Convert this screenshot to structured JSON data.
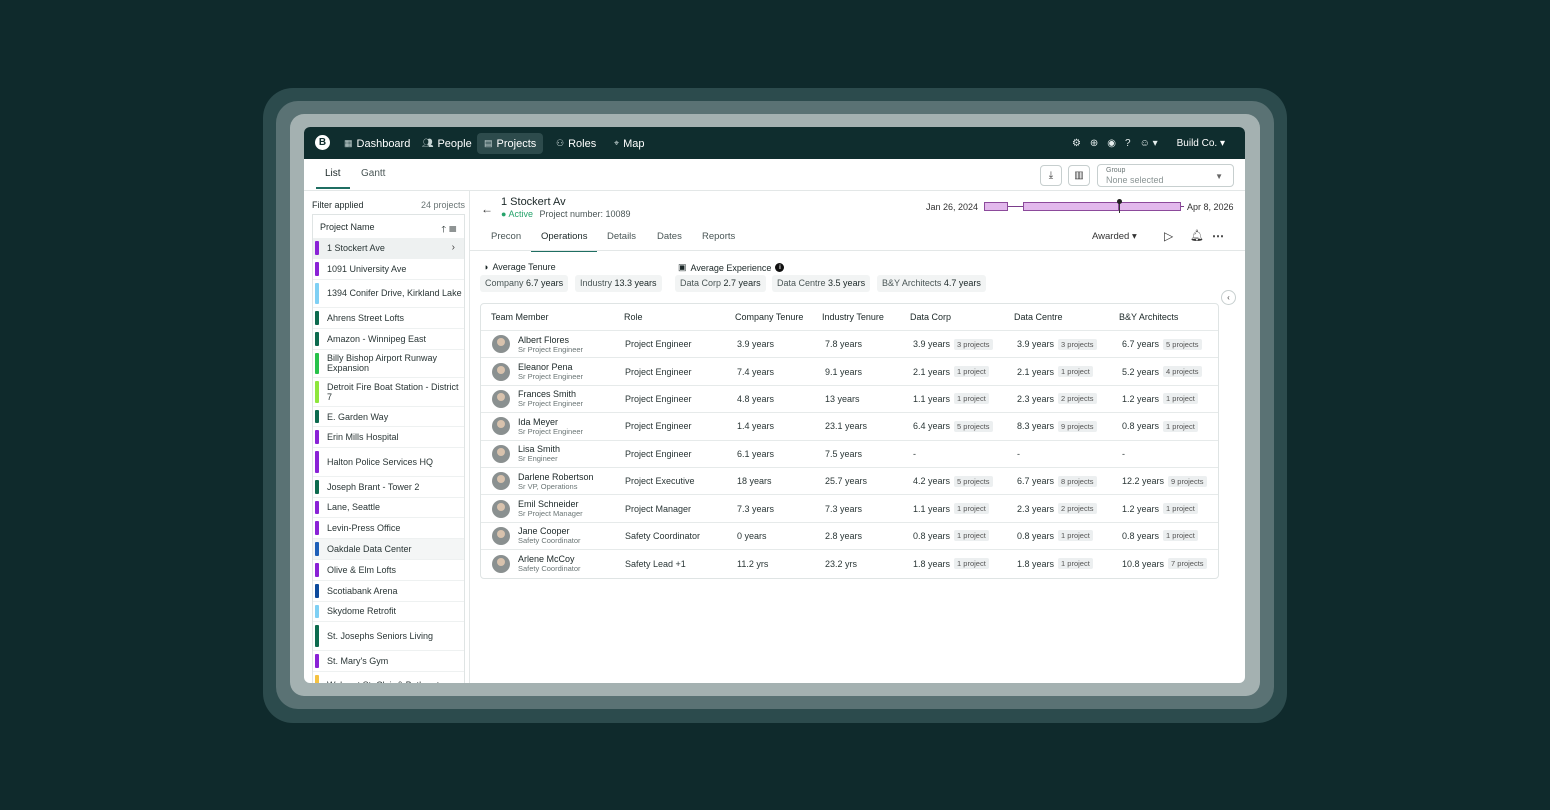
{
  "nav": {
    "logo": "B",
    "items": [
      {
        "label": "Dashboard",
        "icon": "grid-icon"
      },
      {
        "label": "People",
        "icon": "people-icon"
      },
      {
        "label": "Projects",
        "icon": "building-icon"
      },
      {
        "label": "Roles",
        "icon": "roles-icon"
      },
      {
        "label": "Map",
        "icon": "pin-icon"
      }
    ],
    "company": "Build Co."
  },
  "views": {
    "list": "List",
    "gantt": "Gantt"
  },
  "group": {
    "label": "Group",
    "value": "None selected"
  },
  "sidebar": {
    "filter_label": "Filter applied",
    "count": "24 projects",
    "column_header": "Project Name",
    "projects": [
      {
        "name": "1 Stockert Ave",
        "color": "#8a22d6"
      },
      {
        "name": "1091 University Ave",
        "color": "#8a22d6"
      },
      {
        "name": "1394 Conifer Drive, Kirkland Lake",
        "color": "#7fd0f4"
      },
      {
        "name": "Ahrens Street Lofts",
        "color": "#0d6b4e"
      },
      {
        "name": "Amazon - Winnipeg East",
        "color": "#0d6b4e"
      },
      {
        "name": "Billy Bishop Airport Runway Expansion",
        "color": "#27c24a"
      },
      {
        "name": "Detroit Fire Boat Station - District 7",
        "color": "#8ee63c"
      },
      {
        "name": "E. Garden Way",
        "color": "#0d6b4e"
      },
      {
        "name": "Erin Mills Hospital",
        "color": "#8a22d6"
      },
      {
        "name": "Halton Police Services HQ",
        "color": "#8a22d6"
      },
      {
        "name": "Joseph Brant - Tower 2",
        "color": "#0d6b4e"
      },
      {
        "name": "Lane, Seattle",
        "color": "#8a22d6"
      },
      {
        "name": "Levin-Press Office",
        "color": "#8a22d6"
      },
      {
        "name": "Oakdale Data Center",
        "color": "#1e5fb8"
      },
      {
        "name": "Olive & Elm Lofts",
        "color": "#8a22d6"
      },
      {
        "name": "Scotiabank Arena",
        "color": "#0d4a9c"
      },
      {
        "name": "Skydome Retrofit",
        "color": "#7fd0f4"
      },
      {
        "name": "St. Josephs Seniors Living",
        "color": "#0d6b4e"
      },
      {
        "name": "St. Mary's Gym",
        "color": "#8a22d6"
      },
      {
        "name": "Walmart St. Clair & Bathurst",
        "color": "#f5c242"
      }
    ]
  },
  "project": {
    "title": "1 Stockert Av",
    "status": "Active",
    "number": "Project number: 10089",
    "start_date": "Jan 26, 2024",
    "end_date": "Apr 8, 2026",
    "tabs": [
      "Precon",
      "Operations",
      "Details",
      "Dates",
      "Reports"
    ],
    "stage": "Awarded"
  },
  "stats": {
    "tenure_title": "Average Tenure",
    "experience_title": "Average Experience",
    "tenure": [
      {
        "label": "Company",
        "value": "6.7 years"
      },
      {
        "label": "Industry",
        "value": "13.3 years"
      }
    ],
    "experience": [
      {
        "label": "Data Corp",
        "value": "2.7 years"
      },
      {
        "label": "Data Centre",
        "value": "3.5 years"
      },
      {
        "label": "B&Y Architects",
        "value": "4.7 years"
      }
    ]
  },
  "table": {
    "headers": [
      "Team Member",
      "Role",
      "Company Tenure",
      "Industry Tenure",
      "Data Corp",
      "Data Centre",
      "B&Y Architects"
    ],
    "rows": [
      {
        "name": "Albert Flores",
        "title": "Sr Project Engineer",
        "role": "Project Engineer",
        "company": "3.9 years",
        "industry": "7.8 years",
        "dc": "3.9 years",
        "dc_p": "3 projects",
        "dce": "3.9 years",
        "dce_p": "3 projects",
        "by": "6.7 years",
        "by_p": "5 projects"
      },
      {
        "name": "Eleanor Pena",
        "title": "Sr Project Engineer",
        "role": "Project Engineer",
        "company": "7.4 years",
        "industry": "9.1 years",
        "dc": "2.1 years",
        "dc_p": "1 project",
        "dce": "2.1 years",
        "dce_p": "1 project",
        "by": "5.2 years",
        "by_p": "4 projects"
      },
      {
        "name": "Frances Smith",
        "title": "Sr Project Engineer",
        "role": "Project Engineer",
        "company": "4.8 years",
        "industry": "13 years",
        "dc": "1.1 years",
        "dc_p": "1 project",
        "dce": "2.3 years",
        "dce_p": "2 projects",
        "by": "1.2 years",
        "by_p": "1 project"
      },
      {
        "name": "Ida Meyer",
        "title": "Sr Project Engineer",
        "role": "Project Engineer",
        "company": "1.4 years",
        "industry": "23.1 years",
        "dc": "6.4 years",
        "dc_p": "5 projects",
        "dce": "8.3 years",
        "dce_p": "9 projects",
        "by": "0.8 years",
        "by_p": "1 project"
      },
      {
        "name": "Lisa Smith",
        "title": "Sr Engineer",
        "role": "Project Engineer",
        "company": "6.1 years",
        "industry": "7.5 years",
        "dc": "-",
        "dc_p": "",
        "dce": "-",
        "dce_p": "",
        "by": "-",
        "by_p": ""
      },
      {
        "name": "Darlene Robertson",
        "title": "Sr VP, Operations",
        "role": "Project Executive",
        "company": "18 years",
        "industry": "25.7 years",
        "dc": "4.2 years",
        "dc_p": "5 projects",
        "dce": "6.7 years",
        "dce_p": "8 projects",
        "by": "12.2 years",
        "by_p": "9 projects"
      },
      {
        "name": "Emil Schneider",
        "title": "Sr Project Manager",
        "role": "Project Manager",
        "company": "7.3 years",
        "industry": "7.3 years",
        "dc": "1.1 years",
        "dc_p": "1 project",
        "dce": "2.3 years",
        "dce_p": "2 projects",
        "by": "1.2 years",
        "by_p": "1 project"
      },
      {
        "name": "Jane Cooper",
        "title": "Safety Coordinator",
        "role": "Safety Coordinator",
        "company": "0 years",
        "industry": "2.8 years",
        "dc": "0.8 years",
        "dc_p": "1 project",
        "dce": "0.8 years",
        "dce_p": "1 project",
        "by": "0.8 years",
        "by_p": "1 project"
      },
      {
        "name": "Arlene McCoy",
        "title": "Safety Coordinator",
        "role": "Safety Lead +1",
        "company": "11.2 yrs",
        "industry": "23.2 yrs",
        "dc": "1.8 years",
        "dc_p": "1 project",
        "dce": "1.8 years",
        "dce_p": "1 project",
        "by": "10.8 years",
        "by_p": "7 projects"
      }
    ]
  }
}
